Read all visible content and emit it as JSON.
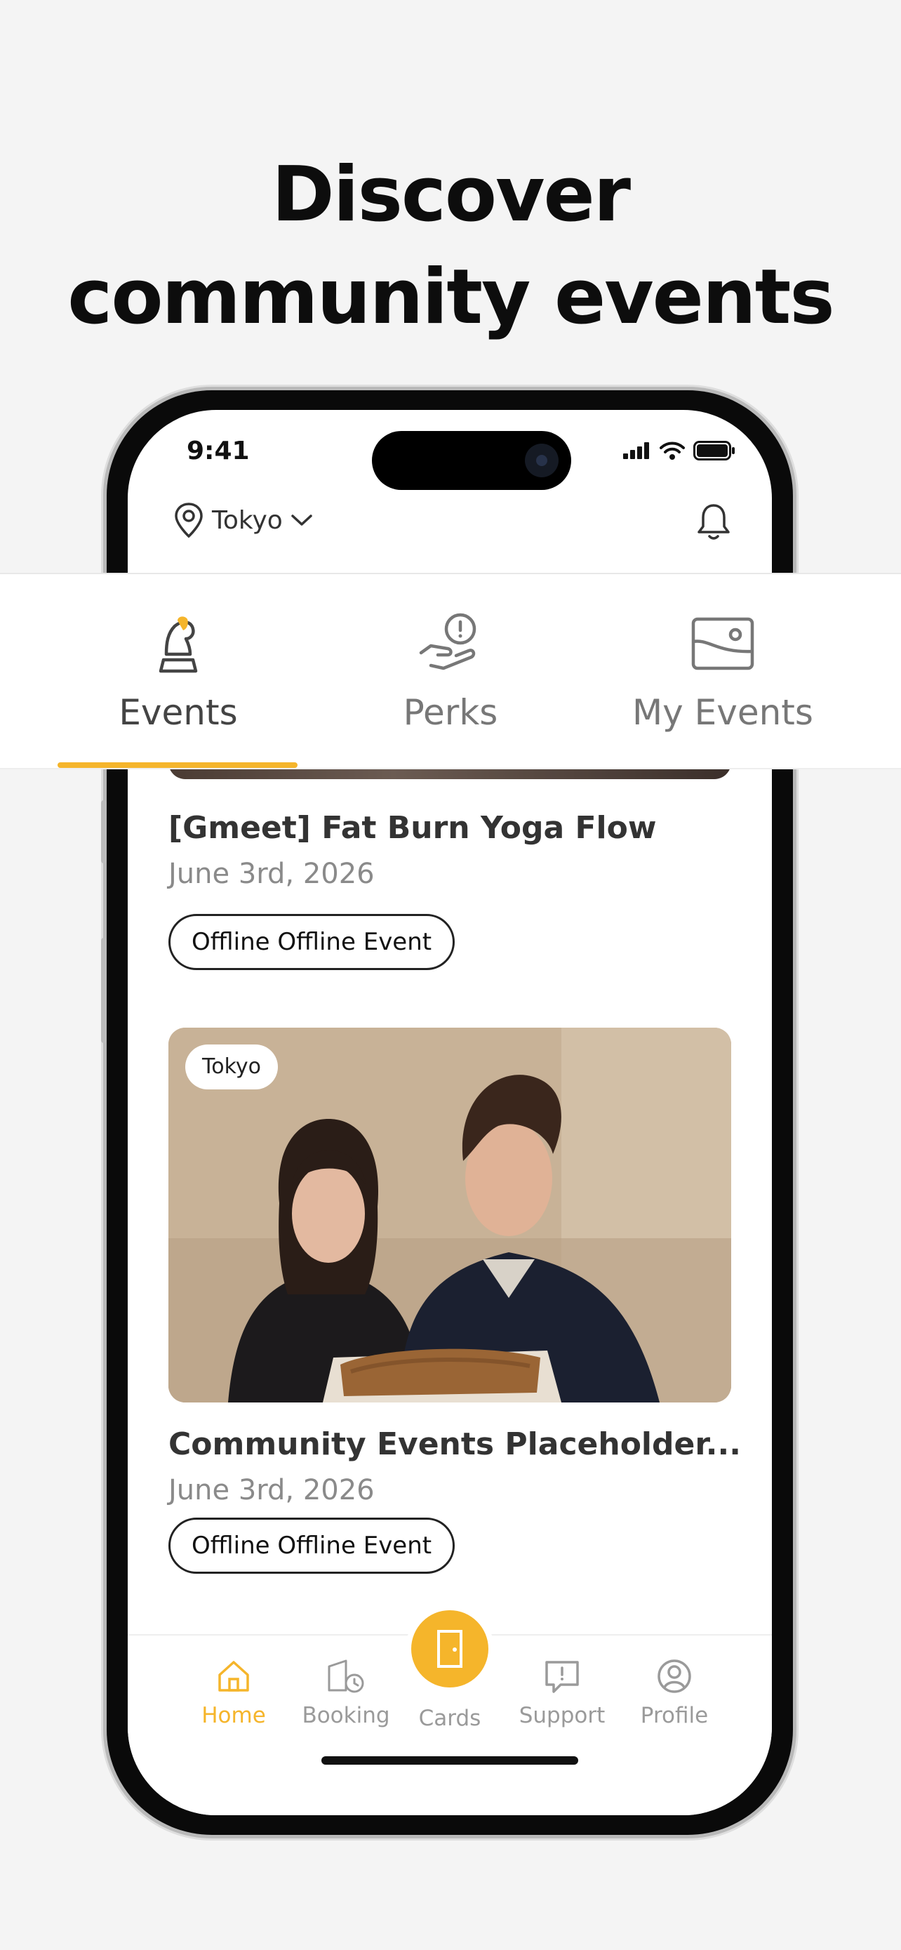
{
  "headline": {
    "line1": "Discover",
    "line2": "community events"
  },
  "status_bar": {
    "time": "9:41"
  },
  "header": {
    "location": "Tokyo",
    "location_icon": "pin-icon",
    "notification_icon": "bell-icon"
  },
  "tabs": [
    {
      "label": "Events",
      "icon": "knight-icon",
      "active": true
    },
    {
      "label": "Perks",
      "icon": "hand-coin-icon",
      "active": false
    },
    {
      "label": "My Events",
      "icon": "image-icon",
      "active": false
    }
  ],
  "events": [
    {
      "title": "[Gmeet] Fat Burn Yoga Flow",
      "date": "June 3rd, 2026",
      "tag": "Offline Offline Event"
    },
    {
      "badge": "Tokyo",
      "title": "Community Events Placeholder...",
      "date": "June 3rd, 2026",
      "tag": "Offline Offline Event"
    }
  ],
  "bottom_nav": [
    {
      "label": "Home",
      "icon": "home-icon",
      "active": true
    },
    {
      "label": "Booking",
      "icon": "booking-icon",
      "active": false
    },
    {
      "label": "Cards",
      "icon": "door-icon",
      "active": false
    },
    {
      "label": "Support",
      "icon": "chat-icon",
      "active": false
    },
    {
      "label": "Profile",
      "icon": "profile-icon",
      "active": false
    }
  ],
  "colors": {
    "accent": "#f5b52b",
    "background": "#f4f4f4",
    "text": "#333333",
    "muted": "#8a8a8a"
  }
}
